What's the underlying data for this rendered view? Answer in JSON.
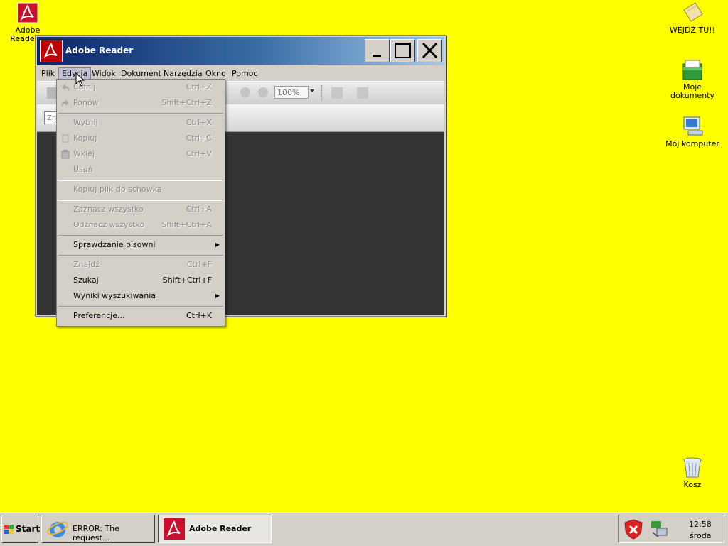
{
  "desktop": {
    "icons": [
      {
        "label": "Adobe Reader 9",
        "icon": "adobe-reader-icon"
      },
      {
        "label": "WEJDŹ TU!!",
        "icon": "folder-icon"
      },
      {
        "label": "Moje dokumenty",
        "icon": "my-documents-icon"
      },
      {
        "label": "Mój komputer",
        "icon": "my-computer-icon"
      },
      {
        "label": "Kosz",
        "icon": "recycle-bin-icon"
      }
    ],
    "background_color": "#ffff00"
  },
  "window": {
    "title": "Adobe Reader",
    "menu": [
      "Plik",
      "Edycja",
      "Widok",
      "Dokument",
      "Narzędzia",
      "Okno",
      "Pomoc"
    ],
    "active_menu": "Edycja",
    "zoom": "100%",
    "find_placeholder": "Zn"
  },
  "edit_menu": {
    "items": [
      {
        "label": "Cofnij",
        "shortcut": "Ctrl+Z",
        "enabled": false
      },
      {
        "label": "Ponów",
        "shortcut": "Shift+Ctrl+Z",
        "enabled": false
      },
      {
        "label": "Wytnij",
        "shortcut": "Ctrl+X",
        "enabled": false
      },
      {
        "label": "Kopiuj",
        "shortcut": "Ctrl+C",
        "enabled": false
      },
      {
        "label": "Wklej",
        "shortcut": "Ctrl+V",
        "enabled": false
      },
      {
        "label": "Usuń",
        "shortcut": "",
        "enabled": false
      },
      {
        "label": "Kopiuj plik do schowka",
        "shortcut": "",
        "enabled": false
      },
      {
        "label": "Zaznacz wszystko",
        "shortcut": "Ctrl+A",
        "enabled": false
      },
      {
        "label": "Odznacz wszystko",
        "shortcut": "Shift+Ctrl+A",
        "enabled": false
      },
      {
        "label": "Sprawdzanie pisowni",
        "shortcut": "",
        "enabled": true,
        "submenu": true
      },
      {
        "label": "Znajdź",
        "shortcut": "Ctrl+F",
        "enabled": false
      },
      {
        "label": "Szukaj",
        "shortcut": "Shift+Ctrl+F",
        "enabled": true
      },
      {
        "label": "Wyniki wyszukiwania",
        "shortcut": "",
        "enabled": true,
        "submenu": true
      },
      {
        "label": "Preferencje...",
        "shortcut": "Ctrl+K",
        "enabled": true
      }
    ]
  },
  "taskbar": {
    "start_label": "Start",
    "tasks": [
      {
        "label": "ERROR: The request...",
        "icon": "internet-explorer-icon",
        "active": false
      },
      {
        "label": "Adobe Reader",
        "icon": "adobe-reader-icon",
        "active": true
      }
    ],
    "clock_time": "12:58",
    "clock_day": "środa"
  }
}
